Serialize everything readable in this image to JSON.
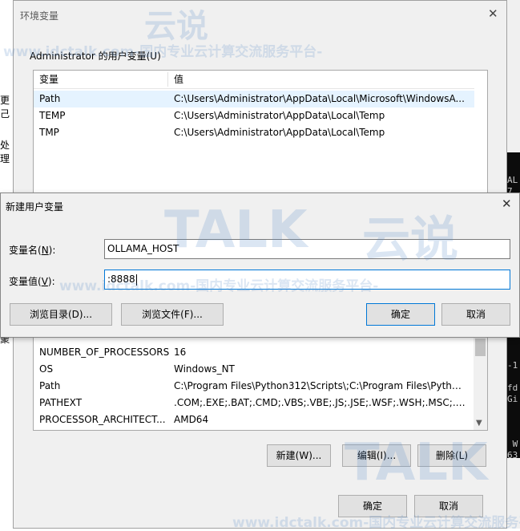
{
  "env_window": {
    "title": "环境变量",
    "close_glyph": "✕",
    "user_group_label": "Administrator 的用户变量(U)",
    "user_vars_header": {
      "name": "变量",
      "value": "值"
    },
    "user_vars": [
      {
        "name": "Path",
        "value": "C:\\Users\\Administrator\\AppData\\Local\\Microsoft\\WindowsA..."
      },
      {
        "name": "TEMP",
        "value": "C:\\Users\\Administrator\\AppData\\Local\\Temp"
      },
      {
        "name": "TMP",
        "value": "C:\\Users\\Administrator\\AppData\\Local\\Temp"
      }
    ],
    "system_vars": [
      {
        "name": "NUMBER_OF_PROCESSORS",
        "value": "16"
      },
      {
        "name": "OS",
        "value": "Windows_NT"
      },
      {
        "name": "Path",
        "value": "C:\\Program Files\\Python312\\Scripts\\;C:\\Program Files\\Python..."
      },
      {
        "name": "PATHEXT",
        "value": ".COM;.EXE;.BAT;.CMD;.VBS;.VBE;.JS;.JSE;.WSF;.WSH;.MSC;.PY;.P..."
      },
      {
        "name": "PROCESSOR_ARCHITECT...",
        "value": "AMD64"
      }
    ],
    "system_buttons": {
      "new": "新建(W)...",
      "edit": "编辑(I)...",
      "delete": "删除(L)"
    },
    "bottom_buttons": {
      "ok": "确定",
      "cancel": "取消"
    }
  },
  "new_var_dialog": {
    "title": "新建用户变量",
    "close_glyph": "✕",
    "name_label_pre": "变量名(",
    "name_label_key": "N",
    "name_label_post": "):",
    "name_value": "OLLAMA_HOST",
    "value_label_pre": "变量值(",
    "value_label_key": "V",
    "value_label_post": "):",
    "value_value": ":8888",
    "browse_dir": "浏览目录(D)...",
    "browse_file": "浏览文件(F)...",
    "ok": "确定",
    "cancel": "取消"
  },
  "background": {
    "left_fragments": [
      "更己",
      "处理",
      "聚"
    ],
    "terminal_lines": [
      "",
      "",
      "",
      "",
      "",
      "",
      "",
      "",
      "",
      "",
      "",
      "",
      "",
      "",
      "AL",
      "7.",
      "13",
      "",
      "",
      "",
      "",
      "",
      "",
      "",
      "",
      "",
      "",
      "",
      "",
      "",
      "-1",
      "",
      "fd",
      "Gi",
      "",
      "",
      "",
      " W",
      "63",
      "6."
    ]
  },
  "watermark": {
    "brand_latin": "TALK",
    "brand_cn": "云说",
    "url_line": "www.idctalk.com-国内专业云计算交流服务平台-"
  },
  "colors": {
    "selection": "#e5f3ff",
    "focus_border": "#0078d7",
    "dialog_bg": "#f0f0f0",
    "button_bg": "#e1e1e1"
  }
}
